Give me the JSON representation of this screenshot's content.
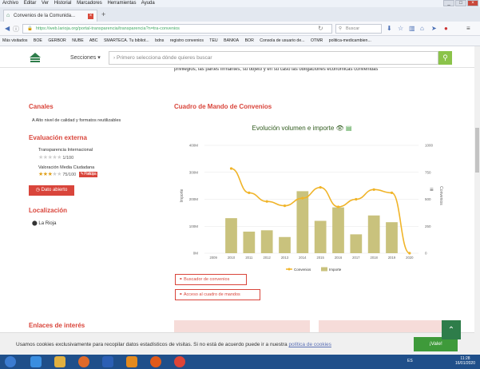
{
  "browser": {
    "menu": [
      "Archivo",
      "Editar",
      "Ver",
      "Historial",
      "Marcadores",
      "Herramientas",
      "Ayuda"
    ],
    "tab_title": "Convenios de la Comunida...",
    "new_tab": "+",
    "url": "https://web.larioja.org/portal-transparencia/transparencia?n=tra-convenios",
    "search_placeholder": "Buscar",
    "bookmarks": [
      "Más visitados",
      "BOE",
      "GERBOR",
      "NUBE",
      "ABC",
      "SMARTECA. Tu bibliot...",
      "bdns",
      "registro convenios",
      "TEU",
      "BANKIA",
      "BOR",
      "Consola de usuario de...",
      "OTMR",
      "politica-medicambien..."
    ]
  },
  "site": {
    "sections_label": "Secciones",
    "search_placeholder": "Primero selecciona dónde quieres buscar",
    "cut_text": "privilegios, las partes firmantes, su objeto y en su caso las obligaciones económicas convenidas"
  },
  "sidebar": {
    "canales_heading": "Canales",
    "canales_text": "A Alto nivel de calidad y formatos reutilizables",
    "evaluacion_heading": "Evaluación externa",
    "ti_label": "Transparencia Internacional",
    "ti_score": "1/100",
    "ti_stars": 0,
    "vmc_label": "Valoración Media Ciudadana",
    "vmc_score": "75/100",
    "vmc_stars": 3,
    "participa": "Participa",
    "dato_abierto": "Dato abierto",
    "localizacion_heading": "Localización",
    "location": "La Rioja"
  },
  "main": {
    "heading": "Cuadro de Mando de Convenios",
    "buscador_link": "Buscador de convenios",
    "acceso_link": "Acceso al cuadro de mandos",
    "enlaces_heading": "Enlaces de interés"
  },
  "chart_data": {
    "type": "bar",
    "title": "Evolución volumen e importe",
    "categories": [
      "2009",
      "2010",
      "2011",
      "2012",
      "2013",
      "2014",
      "2015",
      "2016",
      "2017",
      "2018",
      "2019",
      "2020"
    ],
    "series": [
      {
        "name": "Importe",
        "type": "bar",
        "axis": "left",
        "color": "#c9c27d",
        "values": [
          null,
          130000000,
          80000000,
          85000000,
          60000000,
          230000000,
          120000000,
          170000000,
          70000000,
          140000000,
          115000000,
          0
        ]
      },
      {
        "name": "Convenios",
        "type": "line",
        "axis": "right",
        "color": "#f0b429",
        "values": [
          null,
          785,
          560,
          480,
          440,
          510,
          610,
          430,
          500,
          590,
          560,
          0
        ]
      }
    ],
    "left_axis": {
      "label": "Importe",
      "ticks": [
        "0M",
        "100M",
        "200M",
        "300M",
        "400M"
      ],
      "ylim": [
        0,
        400000000
      ]
    },
    "right_axis": {
      "label": "Convenios",
      "ticks": [
        "0",
        "250",
        "500",
        "750",
        "1000"
      ],
      "ylim": [
        0,
        1000
      ]
    },
    "legend_position": "bottom",
    "grid": true
  },
  "cookie": {
    "text": "Usamos cookies exclusivamente para recopilar datos estadísticos de visitas. Si no está de acuerdo puede ir a nuestra",
    "link": "política de cookies",
    "button": "¡Vale!"
  },
  "taskbar": {
    "lang": "ES",
    "time": "11:28",
    "date": "16/01/2020"
  }
}
